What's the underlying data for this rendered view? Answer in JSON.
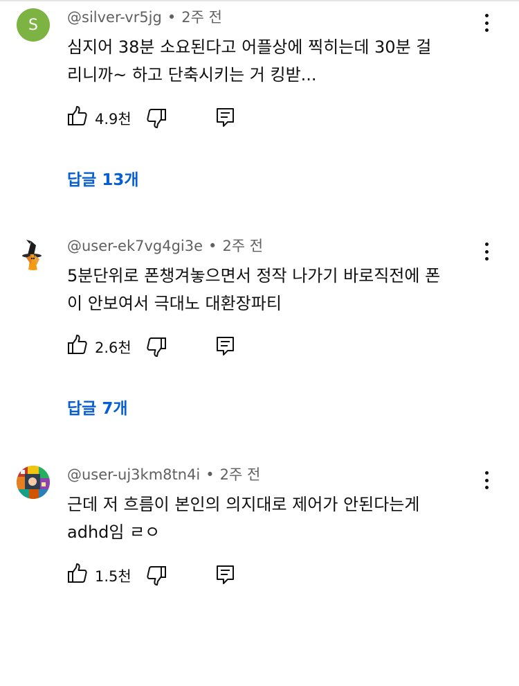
{
  "comments": [
    {
      "avatar_letter": "S",
      "avatar_color": "#7cb342",
      "author": "@silver-vr5jg",
      "time": "2주 전",
      "text_line1": "심지어 38분 소요된다고 어플상에 찍히는데 30분 걸",
      "text_line2": "리니까~ 하고 단축시키는 거 킹받...",
      "likes": "4.9천",
      "replies": "답글 13개"
    },
    {
      "avatar_icon": "witch-hat-avatar-icon",
      "author": "@user-ek7vg4gi3e",
      "time": "2주 전",
      "text_line1": "5분단위로 폰챙겨놓으면서 정작 나가기 바로직전에 폰",
      "text_line2": "이 안보여서 극대노 대환장파티",
      "likes": "2.6천",
      "replies": "답글 7개"
    },
    {
      "avatar_icon": "colorful-collage-avatar-icon",
      "author": "@user-uj3km8tn4i",
      "time": "2주 전",
      "text_line1": "근데 저 흐름이 본인의 의지대로 제어가 안된다는게",
      "text_line2": "adhd임 ㄹㅇ",
      "likes": "1.5천"
    }
  ],
  "separator": "•",
  "colors": {
    "link": "#065fd4",
    "meta": "#606060",
    "text": "#0f0f0f"
  }
}
